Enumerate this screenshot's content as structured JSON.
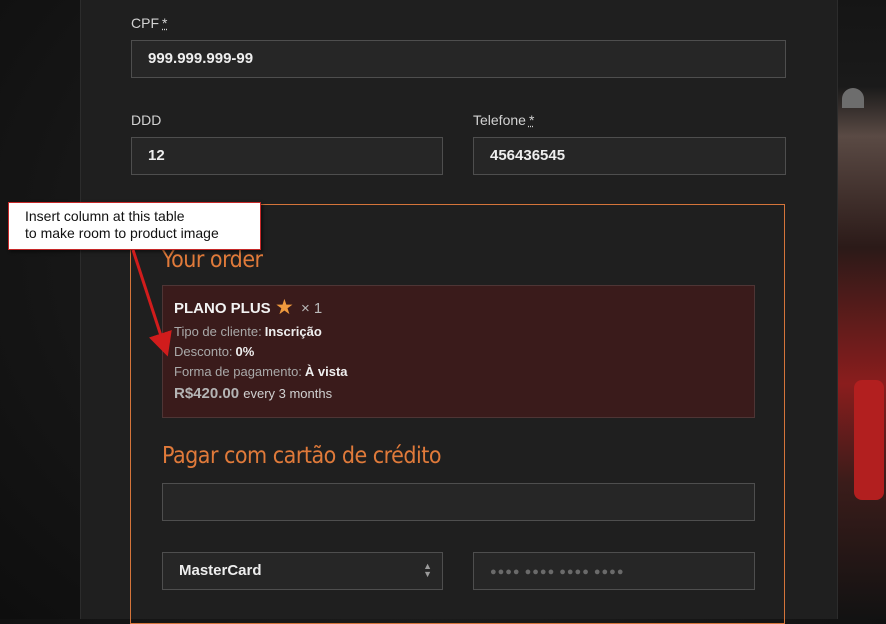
{
  "form": {
    "cpf": {
      "label": "CPF",
      "required_mark": "*",
      "value": "999.999.999-99"
    },
    "ddd": {
      "label": "DDD",
      "value": "12"
    },
    "telefone": {
      "label": "Telefone",
      "required_mark": "*",
      "value": "456436545"
    }
  },
  "order": {
    "title": "Your order",
    "product": {
      "name": "PLANO PLUS",
      "star_icon": "star-icon",
      "quantity": "× 1",
      "meta": [
        {
          "key": "Tipo de cliente:",
          "value": "Inscrição"
        },
        {
          "key": "Desconto:",
          "value": "0%"
        },
        {
          "key": "Forma de pagamento:",
          "value": "À vista"
        }
      ],
      "price": "R$420.00",
      "period": "every 3 months"
    }
  },
  "payment": {
    "title": "Pagar com cartão de crédito",
    "name_value": "",
    "card_type": "MasterCard",
    "card_number_placeholder": "●●●● ●●●● ●●●● ●●●●"
  },
  "annotation": {
    "line1": "Insert column at this table",
    "line2": "to make room to product image"
  },
  "colors": {
    "accent": "#e07a3a",
    "product_bg": "#3a1b1b",
    "annotation_border": "#c62828"
  }
}
